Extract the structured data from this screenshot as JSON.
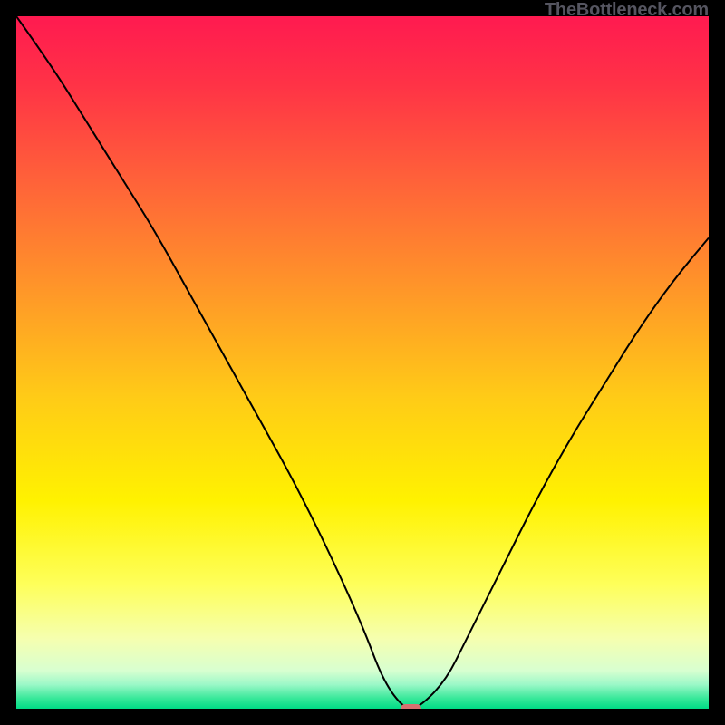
{
  "attribution": "TheBottleneck.com",
  "chart_data": {
    "type": "line",
    "title": "",
    "xlabel": "",
    "ylabel": "",
    "xlim": [
      0,
      100
    ],
    "ylim": [
      0,
      100
    ],
    "series": [
      {
        "name": "bottleneck-curve",
        "x": [
          0,
          5,
          10,
          15,
          20,
          25,
          30,
          35,
          40,
          45,
          50,
          53,
          56,
          58,
          62,
          65,
          70,
          75,
          80,
          85,
          90,
          95,
          100
        ],
        "values": [
          100,
          93,
          85,
          77,
          69,
          60,
          51,
          42,
          33,
          23,
          12,
          4,
          0,
          0,
          4,
          10,
          20,
          30,
          39,
          47,
          55,
          62,
          68
        ]
      }
    ],
    "optimum_marker": {
      "x": 57,
      "y": 0,
      "color": "#d77070",
      "width_pct": 3.0,
      "height_pct": 1.3
    },
    "gradient_stops": [
      {
        "offset": 0.0,
        "color": "#ff1a50"
      },
      {
        "offset": 0.1,
        "color": "#ff3346"
      },
      {
        "offset": 0.25,
        "color": "#ff6638"
      },
      {
        "offset": 0.4,
        "color": "#ff9828"
      },
      {
        "offset": 0.55,
        "color": "#ffcb17"
      },
      {
        "offset": 0.7,
        "color": "#fff200"
      },
      {
        "offset": 0.82,
        "color": "#feff5a"
      },
      {
        "offset": 0.9,
        "color": "#f5ffb0"
      },
      {
        "offset": 0.945,
        "color": "#d8ffd0"
      },
      {
        "offset": 0.965,
        "color": "#9cf8c8"
      },
      {
        "offset": 0.985,
        "color": "#38e89a"
      },
      {
        "offset": 1.0,
        "color": "#00db85"
      }
    ]
  }
}
